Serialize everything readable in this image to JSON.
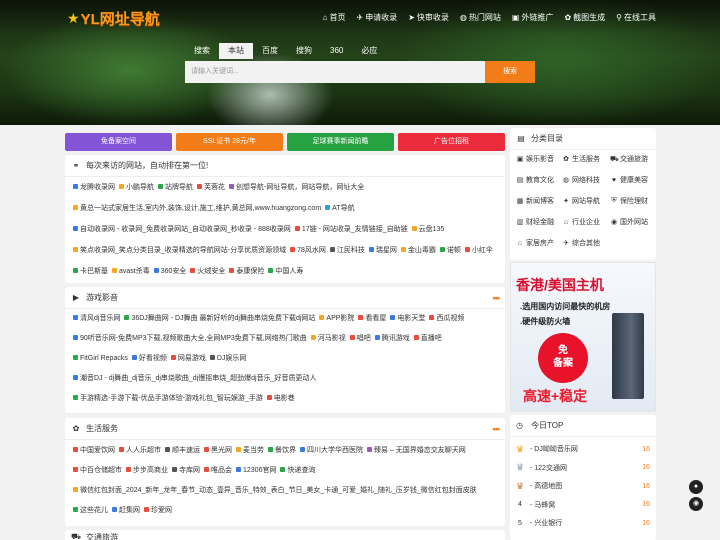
{
  "header": {
    "logo_text": "YL网址导航"
  },
  "nav": [
    {
      "icon": "home-icon",
      "glyph": "⌂",
      "label": "首页"
    },
    {
      "icon": "plane-icon",
      "glyph": "✈",
      "label": "申请收录"
    },
    {
      "icon": "arrow-icon",
      "glyph": "➤",
      "label": "快审收录"
    },
    {
      "icon": "globe-icon",
      "glyph": "◍",
      "label": "热门网站"
    },
    {
      "icon": "box-icon",
      "glyph": "▣",
      "label": "外链推广"
    },
    {
      "icon": "cog-icon",
      "glyph": "✿",
      "label": "截图生成"
    },
    {
      "icon": "link-icon",
      "glyph": "⚲",
      "label": "在线工具"
    }
  ],
  "search": {
    "tabs": [
      "搜索",
      "本站",
      "百度",
      "搜狗",
      "360",
      "必应"
    ],
    "active": 1,
    "placeholder": "请输入关键词...",
    "button": "搜索"
  },
  "banners": [
    {
      "label": "免备案空间",
      "color": "#8454d6"
    },
    {
      "label": "SSL证书 28元/年",
      "color": "#f17c18"
    },
    {
      "label": "足球赛事新闻前瞻",
      "color": "#27a242"
    },
    {
      "label": "广告位招租",
      "color": "#ea2c3b"
    }
  ],
  "recent": {
    "title": "每次来访的网站，自动排在第一位!",
    "lines": [
      [
        {
          "t": "龙腾收录网",
          "c": "#3b7be0"
        },
        {
          "t": "小鹏导航",
          "c": "#f5a623"
        },
        {
          "t": "站牌导航",
          "c": "#29a84a"
        },
        {
          "t": "芙蓉花",
          "c": "#e74c3c"
        },
        {
          "t": "创想导航-网址导航，网站导航，网址大全",
          "c": "#9b59b6"
        }
      ],
      [
        {
          "t": "黄总一站式家居生活,室内外,装饰,设计,施工,维护,黄总网,www.huangzong.com",
          "c": "#f5a623"
        },
        {
          "t": "AT导航",
          "c": "#2c9fd8"
        }
      ],
      [
        {
          "t": "自动收录网 - 收录网_免费收录网站_自动收录网_秒收录 - 888收录网",
          "c": "#3b7be0"
        },
        {
          "t": "17链 - 网站收录_友情链接_自助链",
          "c": "#e74c3c"
        },
        {
          "t": "云盘135",
          "c": "#f5a623"
        }
      ],
      [
        {
          "t": "笑点收录网_笑点分类目录_收录精选的导航网站-分享优质资源领域",
          "c": "#f5a623"
        },
        {
          "t": "78风水网",
          "c": "#e74c3c"
        },
        {
          "t": "江民科技",
          "c": "#555"
        },
        {
          "t": "瑞星网",
          "c": "#3b7be0"
        },
        {
          "t": "金山毒霸",
          "c": "#f5a623"
        },
        {
          "t": "诺顿",
          "c": "#29a84a"
        },
        {
          "t": "小红伞",
          "c": "#e74c3c"
        }
      ],
      [
        {
          "t": "卡巴斯基",
          "c": "#29a84a"
        },
        {
          "t": "avast杀毒",
          "c": "#f5a623"
        },
        {
          "t": "360安全",
          "c": "#3b7be0"
        },
        {
          "t": "火绒安全",
          "c": "#e74c3c"
        },
        {
          "t": "泰康保险",
          "c": "#e74c3c"
        },
        {
          "t": "中国人寿",
          "c": "#29a84a"
        }
      ]
    ]
  },
  "games": {
    "title": "游戏影音",
    "icon": "video-icon",
    "lines": [
      [
        {
          "t": "清风dj音乐网",
          "c": "#3b7be0"
        },
        {
          "t": "36DJ舞曲网 - DJ舞曲 最新好听的dj舞曲串烧免费下载dj网站",
          "c": "#29a84a"
        },
        {
          "t": "APP影院",
          "c": "#f5a623"
        },
        {
          "t": "看看屋",
          "c": "#e74c3c"
        },
        {
          "t": "电影天堂",
          "c": "#3b7be0"
        },
        {
          "t": "西瓜视频",
          "c": "#e74c3c"
        }
      ],
      [
        {
          "t": "90听音乐网-免费MP3下载,视频歌曲大全,全网MP3免费下载,网络热门歌曲",
          "c": "#3b7be0"
        },
        {
          "t": "河马影视",
          "c": "#f5a623"
        },
        {
          "t": "唱吧",
          "c": "#e74c3c"
        },
        {
          "t": "腾讯游戏",
          "c": "#3b7be0"
        },
        {
          "t": "直播吧",
          "c": "#e74c3c"
        }
      ],
      [
        {
          "t": "FitGirl Repacks",
          "c": "#29a84a"
        },
        {
          "t": "好看视频",
          "c": "#3b7be0"
        },
        {
          "t": "网易游戏",
          "c": "#e74c3c"
        },
        {
          "t": "DJ娱乐网",
          "c": "#555"
        }
      ],
      [
        {
          "t": "潮音DJ - dj舞曲_dj音乐_dj串烧歌曲_dj慢摇串烧_超劲爆dj音乐_好音质更动人",
          "c": "#3b7be0"
        }
      ],
      [
        {
          "t": "手游精选-手游下载-优品手游体验-游戏礼包_智玩娱游_手游",
          "c": "#29a84a"
        },
        {
          "t": "电影巷",
          "c": "#e74c3c"
        }
      ]
    ]
  },
  "life": {
    "title": "生活服务",
    "icon": "gear-icon",
    "lines": [
      [
        {
          "t": "中国爱饮网",
          "c": "#e74c3c"
        },
        {
          "t": "人人乐超市",
          "c": "#e74c3c"
        },
        {
          "t": "顺丰速运",
          "c": "#555"
        },
        {
          "t": "黑光网",
          "c": "#e74c3c"
        },
        {
          "t": "麦当劳",
          "c": "#f5a623"
        },
        {
          "t": "餐饮界",
          "c": "#29a84a"
        },
        {
          "t": "四川大学华西医院",
          "c": "#3b7be0"
        },
        {
          "t": "臻易 – 无国界婚恋交友聊天网",
          "c": "#9b59b6"
        }
      ],
      [
        {
          "t": "中百仓储超市",
          "c": "#e74c3c"
        },
        {
          "t": "步步高商业",
          "c": "#e74c3c"
        },
        {
          "t": "寺库网",
          "c": "#555"
        },
        {
          "t": "唯品会",
          "c": "#e74c3c"
        },
        {
          "t": "12306官网",
          "c": "#3b7be0"
        },
        {
          "t": "快递查询",
          "c": "#29a84a"
        }
      ],
      [
        {
          "t": "微信红包封面_2024_新年_龙年_春节_动态_壹异_音乐_特效_表白_节日_美女_卡通_可爱_婚礼_随礼_压岁钱_微信红包封面皮肤",
          "c": "#f5a623"
        }
      ],
      [
        {
          "t": "这些花儿",
          "c": "#29a84a"
        },
        {
          "t": "赶集网",
          "c": "#3b7be0"
        },
        {
          "t": "珍爱网",
          "c": "#e74c3c"
        }
      ]
    ]
  },
  "next_section": {
    "title": "交通旅游"
  },
  "categories": {
    "title": "分类目录",
    "items": [
      {
        "icon": "video-icon",
        "glyph": "▣",
        "label": "娱乐影音"
      },
      {
        "icon": "gear-icon",
        "glyph": "✿",
        "label": "生活服务"
      },
      {
        "icon": "car-icon",
        "glyph": "⛟",
        "label": "交通旅游"
      },
      {
        "icon": "book-icon",
        "glyph": "▤",
        "label": "教育文化"
      },
      {
        "icon": "globe-icon",
        "glyph": "◍",
        "label": "网络科技"
      },
      {
        "icon": "heart-icon",
        "glyph": "♥",
        "label": "健康美容"
      },
      {
        "icon": "news-icon",
        "glyph": "▦",
        "label": "新闻博客"
      },
      {
        "icon": "compass-icon",
        "glyph": "✦",
        "label": "网站导航"
      },
      {
        "icon": "shield-icon",
        "glyph": "⛨",
        "label": "保险理财"
      },
      {
        "icon": "bank-icon",
        "glyph": "▥",
        "label": "财经金融"
      },
      {
        "icon": "factory-icon",
        "glyph": "⌂",
        "label": "行业企业"
      },
      {
        "icon": "globe-icon",
        "glyph": "◉",
        "label": "国外网站"
      },
      {
        "icon": "house-icon",
        "glyph": "⌂",
        "label": "家居房产"
      },
      {
        "icon": "plane-icon",
        "glyph": "✈",
        "label": "综合其他"
      }
    ]
  },
  "ad": {
    "title": "香港/美国主机",
    "line1": ".选用国内访问最快的机房",
    "line2": ".硬件级防火墙",
    "badge_top": "免",
    "badge_bottom": "备案",
    "footer": "高速+稳定"
  },
  "top": {
    "title": "今日TOP",
    "rows": [
      {
        "rank": "crown",
        "name": "DJ呦呦音乐网",
        "count": "16",
        "color": "#f1a20c"
      },
      {
        "rank": "crown",
        "name": "122交通网",
        "count": "16",
        "color": "#8a9bb5"
      },
      {
        "rank": "crown",
        "name": "高德地图",
        "count": "16",
        "color": "#c87c3a"
      },
      {
        "rank": "4",
        "name": "马蜂窝",
        "count": "16",
        "color": ""
      },
      {
        "rank": "5",
        "name": "兴业银行",
        "count": "16",
        "color": ""
      }
    ]
  },
  "colors": {
    "accent": "#f17c18",
    "link_count": "#f17c18"
  }
}
